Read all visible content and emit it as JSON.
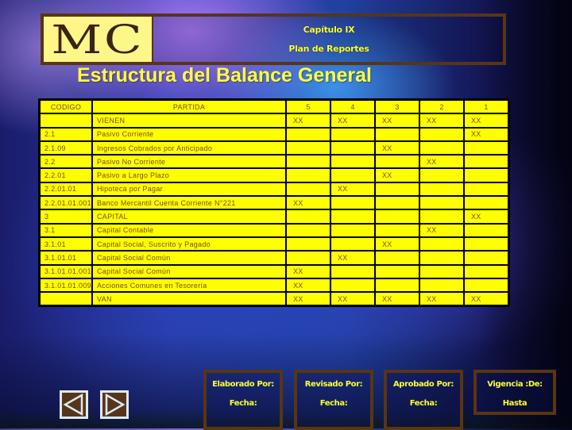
{
  "header": {
    "logo_text": "MC",
    "chapter": "Capítulo IX",
    "subtitle": "Plan de Reportes"
  },
  "page_title": "Estructura del Balance General",
  "table": {
    "headers": [
      "CODIGO",
      "PARTIDA",
      "5",
      "4",
      "3",
      "2",
      "1"
    ],
    "rows": [
      {
        "code": "",
        "desc": "VIENEN",
        "c5": "XX",
        "c4": "XX",
        "c3": "XX",
        "c2": "XX",
        "c1": "XX"
      },
      {
        "code": "2.1",
        "desc": "Pasivo Corriente",
        "c5": "",
        "c4": "",
        "c3": "",
        "c2": "",
        "c1": "XX"
      },
      {
        "code": "2.1.09",
        "desc": "Ingresos Cobrados por Anticipado",
        "c5": "",
        "c4": "",
        "c3": "XX",
        "c2": "",
        "c1": ""
      },
      {
        "code": "2.2",
        "desc": "Pasivo No Corriente",
        "c5": "",
        "c4": "",
        "c3": "",
        "c2": "XX",
        "c1": ""
      },
      {
        "code": "2.2.01",
        "desc": "Pasivo a Largo Plazo",
        "c5": "",
        "c4": "",
        "c3": "XX",
        "c2": "",
        "c1": ""
      },
      {
        "code": "2.2.01.01",
        "desc": "Hipoteca por Pagar",
        "c5": "",
        "c4": "XX",
        "c3": "",
        "c2": "",
        "c1": ""
      },
      {
        "code": "2.2.01.01.001",
        "desc": "Banco Mercantil Cuenta Corriente N°221",
        "c5": "XX",
        "c4": "",
        "c3": "",
        "c2": "",
        "c1": ""
      },
      {
        "code": "3",
        "desc": "CAPITAL",
        "c5": "",
        "c4": "",
        "c3": "",
        "c2": "",
        "c1": "XX"
      },
      {
        "code": "3.1",
        "desc": "Capital Contable",
        "c5": "",
        "c4": "",
        "c3": "",
        "c2": "XX",
        "c1": ""
      },
      {
        "code": "3.1.01",
        "desc": "Capital Social, Suscrito y Pagado",
        "c5": "",
        "c4": "",
        "c3": "XX",
        "c2": "",
        "c1": ""
      },
      {
        "code": "3.1.01.01",
        "desc": "Capital Social Común",
        "c5": "",
        "c4": "XX",
        "c3": "",
        "c2": "",
        "c1": ""
      },
      {
        "code": "3.1.01.01.001",
        "desc": "Capital Social Común",
        "c5": "XX",
        "c4": "",
        "c3": "",
        "c2": "",
        "c1": ""
      },
      {
        "code": "3.1.01.01.009",
        "desc": "Acciones Comunes en Tesorería",
        "c5": "XX",
        "c4": "",
        "c3": "",
        "c2": "",
        "c1": ""
      },
      {
        "code": "",
        "desc": "VAN",
        "c5": "XX",
        "c4": "XX",
        "c3": "XX",
        "c2": "XX",
        "c1": "XX"
      }
    ]
  },
  "navigation": {
    "prev_icon": "triangle-left-icon",
    "next_icon": "triangle-right-icon"
  },
  "footer": {
    "boxes": [
      {
        "label": "Elaborado Por:",
        "sub": "Fecha:"
      },
      {
        "label": "Revisado Por:",
        "sub": "Fecha:"
      },
      {
        "label": "Aprobado Por:",
        "sub": "Fecha:"
      },
      {
        "label": "Vigencia :De:",
        "sub": "Hasta"
      }
    ]
  },
  "colors": {
    "accent_yellow": "#ffff33",
    "table_fill": "#ffff00",
    "table_text": "#7a4a14",
    "frame_brown": "#5a3510",
    "logo_fill": "#fff68a"
  }
}
